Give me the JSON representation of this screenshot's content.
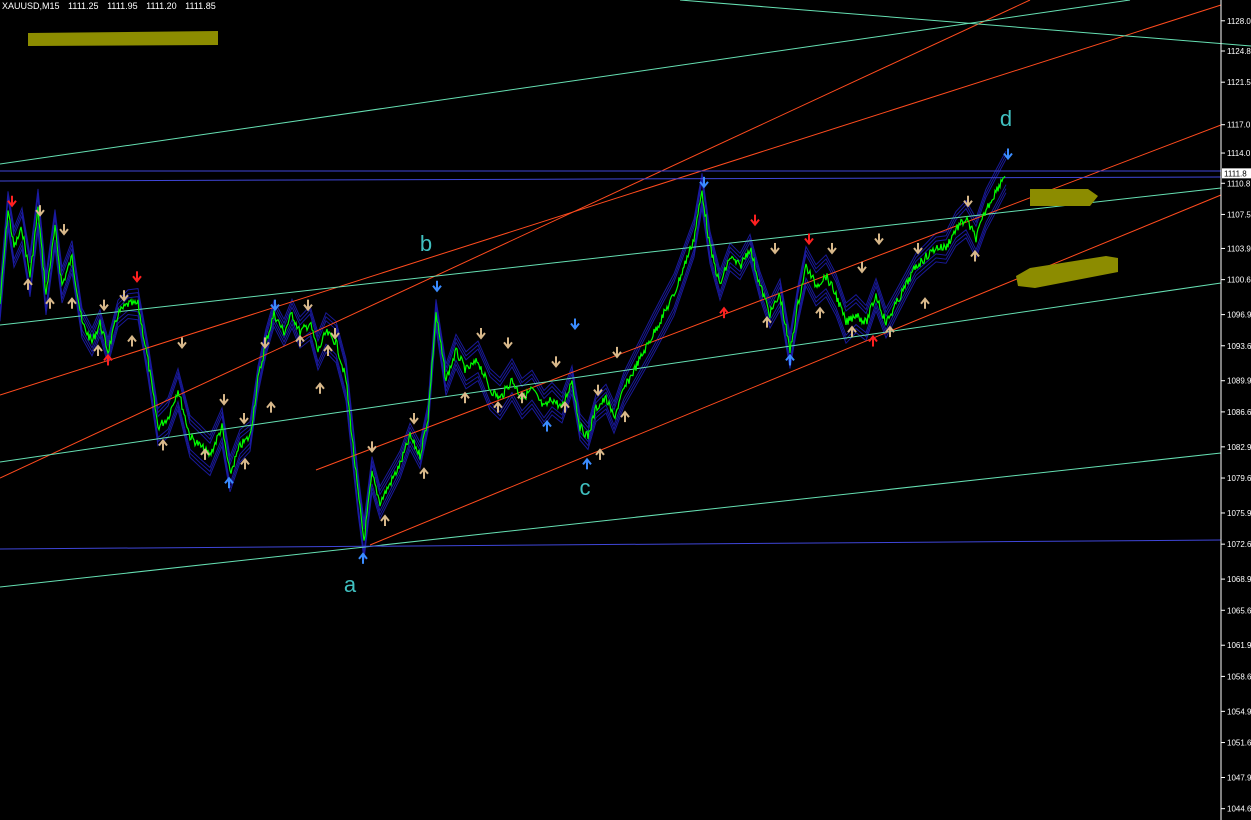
{
  "header": {
    "symbol_tf": "XAUUSD,M15",
    "open": "1111.25",
    "high": "1111.95",
    "low": "1111.20",
    "close": "1111.85"
  },
  "colors": {
    "background": "#000000",
    "price": "#00ff00",
    "envelope": "#1c1ca8",
    "channel_orange": "#ff4b1e",
    "channel_green": "#66e0b3",
    "horizontal": "#3f46d8",
    "label": "#40c0c0",
    "arrow_up_tan": "#d8b88a",
    "arrow_blue": "#3a8cff",
    "arrow_red": "#ff2020",
    "marker_olive": "#8c8c00",
    "axis_text": "#ffffff"
  },
  "chart_data": {
    "type": "line",
    "symbol": "XAUUSD",
    "timeframe": "M15",
    "ylim": [
      1043.0,
      1130.0
    ],
    "y_ticks": [
      "1128.0",
      "1124.8",
      "1121.5",
      "1117.0",
      "1114.0",
      "1110.8",
      "1107.5",
      "1103.9",
      "1100.6",
      "1096.9",
      "1093.6",
      "1089.9",
      "1086.6",
      "1082.9",
      "1079.6",
      "1075.9",
      "1072.6",
      "1068.9",
      "1065.6",
      "1061.9",
      "1058.6",
      "1054.9",
      "1051.6",
      "1047.9",
      "1044.6"
    ],
    "current_price_label": "1111.8",
    "current_price": 1111.85,
    "wave_labels": [
      {
        "label": "a",
        "price": 1072.6
      },
      {
        "label": "b",
        "price": 1103.9
      },
      {
        "label": "c",
        "price": 1082.9
      },
      {
        "label": "d",
        "price": 1111.9
      }
    ],
    "price_path": [
      [
        0,
        1098
      ],
      [
        8,
        1108
      ],
      [
        14,
        1104
      ],
      [
        22,
        1106
      ],
      [
        30,
        1101
      ],
      [
        38,
        1108
      ],
      [
        46,
        1099
      ],
      [
        55,
        1106
      ],
      [
        62,
        1100
      ],
      [
        72,
        1103
      ],
      [
        82,
        1096
      ],
      [
        92,
        1094
      ],
      [
        100,
        1096
      ],
      [
        108,
        1093
      ],
      [
        118,
        1097
      ],
      [
        128,
        1098
      ],
      [
        138,
        1098
      ],
      [
        148,
        1092
      ],
      [
        158,
        1085
      ],
      [
        168,
        1086
      ],
      [
        178,
        1089
      ],
      [
        190,
        1084
      ],
      [
        200,
        1083
      ],
      [
        210,
        1082
      ],
      [
        222,
        1085
      ],
      [
        230,
        1080
      ],
      [
        240,
        1083
      ],
      [
        250,
        1084
      ],
      [
        258,
        1090
      ],
      [
        266,
        1094
      ],
      [
        274,
        1097
      ],
      [
        284,
        1095
      ],
      [
        292,
        1097
      ],
      [
        300,
        1095
      ],
      [
        310,
        1096
      ],
      [
        318,
        1093
      ],
      [
        326,
        1095
      ],
      [
        336,
        1094
      ],
      [
        346,
        1090
      ],
      [
        352,
        1084
      ],
      [
        358,
        1078
      ],
      [
        364,
        1073
      ],
      [
        372,
        1080
      ],
      [
        380,
        1077
      ],
      [
        390,
        1079
      ],
      [
        400,
        1081
      ],
      [
        410,
        1084
      ],
      [
        420,
        1082
      ],
      [
        428,
        1086
      ],
      [
        436,
        1097
      ],
      [
        446,
        1090
      ],
      [
        456,
        1093
      ],
      [
        466,
        1091
      ],
      [
        478,
        1092
      ],
      [
        490,
        1089
      ],
      [
        500,
        1088
      ],
      [
        512,
        1090
      ],
      [
        522,
        1088
      ],
      [
        532,
        1089
      ],
      [
        544,
        1087
      ],
      [
        552,
        1088
      ],
      [
        562,
        1087
      ],
      [
        572,
        1090
      ],
      [
        580,
        1085
      ],
      [
        588,
        1084
      ],
      [
        596,
        1087
      ],
      [
        606,
        1088
      ],
      [
        614,
        1086
      ],
      [
        624,
        1089
      ],
      [
        634,
        1091
      ],
      [
        644,
        1093
      ],
      [
        654,
        1095
      ],
      [
        664,
        1097
      ],
      [
        674,
        1099
      ],
      [
        684,
        1102
      ],
      [
        694,
        1105
      ],
      [
        702,
        1110
      ],
      [
        710,
        1104
      ],
      [
        720,
        1100
      ],
      [
        730,
        1103
      ],
      [
        740,
        1102
      ],
      [
        750,
        1104
      ],
      [
        760,
        1100
      ],
      [
        770,
        1097
      ],
      [
        780,
        1099
      ],
      [
        790,
        1093
      ],
      [
        798,
        1098
      ],
      [
        806,
        1102
      ],
      [
        816,
        1100
      ],
      [
        826,
        1101
      ],
      [
        836,
        1099
      ],
      [
        846,
        1096
      ],
      [
        856,
        1097
      ],
      [
        866,
        1096
      ],
      [
        876,
        1099
      ],
      [
        886,
        1096
      ],
      [
        896,
        1098
      ],
      [
        906,
        1100
      ],
      [
        916,
        1102
      ],
      [
        926,
        1103
      ],
      [
        936,
        1104
      ],
      [
        946,
        1104
      ],
      [
        956,
        1106
      ],
      [
        966,
        1107
      ],
      [
        976,
        1105
      ],
      [
        986,
        1108
      ],
      [
        996,
        1110
      ],
      [
        1006,
        1112
      ]
    ],
    "arrows": [
      {
        "dir": "down",
        "color": "red",
        "px": 12,
        "price": 1108
      },
      {
        "dir": "down",
        "color": "tan",
        "px": 40,
        "price": 1107
      },
      {
        "dir": "down",
        "color": "tan",
        "px": 64,
        "price": 1105
      },
      {
        "dir": "up",
        "color": "tan",
        "px": 28,
        "price": 1101
      },
      {
        "dir": "up",
        "color": "tan",
        "px": 50,
        "price": 1099
      },
      {
        "dir": "up",
        "color": "tan",
        "px": 72,
        "price": 1099
      },
      {
        "dir": "down",
        "color": "tan",
        "px": 104,
        "price": 1097
      },
      {
        "dir": "up",
        "color": "red",
        "px": 108,
        "price": 1093
      },
      {
        "dir": "up",
        "color": "tan",
        "px": 98,
        "price": 1094
      },
      {
        "dir": "down",
        "color": "tan",
        "px": 124,
        "price": 1098
      },
      {
        "dir": "down",
        "color": "red",
        "px": 137,
        "price": 1100
      },
      {
        "dir": "up",
        "color": "tan",
        "px": 132,
        "price": 1095
      },
      {
        "dir": "down",
        "color": "tan",
        "px": 182,
        "price": 1093
      },
      {
        "dir": "up",
        "color": "tan",
        "px": 163,
        "price": 1084
      },
      {
        "dir": "up",
        "color": "tan",
        "px": 205,
        "price": 1083
      },
      {
        "dir": "down",
        "color": "tan",
        "px": 224,
        "price": 1087
      },
      {
        "dir": "up",
        "color": "blue",
        "px": 229,
        "price": 1080
      },
      {
        "dir": "down",
        "color": "tan",
        "px": 244,
        "price": 1085
      },
      {
        "dir": "up",
        "color": "tan",
        "px": 245,
        "price": 1082
      },
      {
        "dir": "down",
        "color": "tan",
        "px": 265,
        "price": 1093
      },
      {
        "dir": "up",
        "color": "tan",
        "px": 271,
        "price": 1088
      },
      {
        "dir": "down",
        "color": "blue",
        "px": 275,
        "price": 1097
      },
      {
        "dir": "down",
        "color": "tan",
        "px": 308,
        "price": 1097
      },
      {
        "dir": "up",
        "color": "tan",
        "px": 300,
        "price": 1095
      },
      {
        "dir": "down",
        "color": "tan",
        "px": 335,
        "price": 1094
      },
      {
        "dir": "up",
        "color": "tan",
        "px": 320,
        "price": 1090
      },
      {
        "dir": "up",
        "color": "tan",
        "px": 328,
        "price": 1094
      },
      {
        "dir": "down",
        "color": "tan",
        "px": 372,
        "price": 1082
      },
      {
        "dir": "up",
        "color": "tan",
        "px": 385,
        "price": 1076
      },
      {
        "dir": "up",
        "color": "blue",
        "px": 363,
        "price": 1072
      },
      {
        "dir": "down",
        "color": "tan",
        "px": 414,
        "price": 1085
      },
      {
        "dir": "up",
        "color": "tan",
        "px": 424,
        "price": 1081
      },
      {
        "dir": "down",
        "color": "blue",
        "px": 437,
        "price": 1099
      },
      {
        "dir": "down",
        "color": "tan",
        "px": 481,
        "price": 1094
      },
      {
        "dir": "up",
        "color": "tan",
        "px": 465,
        "price": 1089
      },
      {
        "dir": "down",
        "color": "tan",
        "px": 508,
        "price": 1093
      },
      {
        "dir": "up",
        "color": "tan",
        "px": 498,
        "price": 1088
      },
      {
        "dir": "up",
        "color": "tan",
        "px": 522,
        "price": 1089
      },
      {
        "dir": "up",
        "color": "blue",
        "px": 547,
        "price": 1086
      },
      {
        "dir": "down",
        "color": "tan",
        "px": 556,
        "price": 1091
      },
      {
        "dir": "up",
        "color": "tan",
        "px": 565,
        "price": 1088
      },
      {
        "dir": "down",
        "color": "blue",
        "px": 575,
        "price": 1095
      },
      {
        "dir": "up",
        "color": "blue",
        "px": 587,
        "price": 1082
      },
      {
        "dir": "up",
        "color": "tan",
        "px": 600,
        "price": 1083
      },
      {
        "dir": "down",
        "color": "tan",
        "px": 598,
        "price": 1088
      },
      {
        "dir": "down",
        "color": "tan",
        "px": 617,
        "price": 1092
      },
      {
        "dir": "up",
        "color": "tan",
        "px": 625,
        "price": 1087
      },
      {
        "dir": "down",
        "color": "blue",
        "px": 704,
        "price": 1110
      },
      {
        "dir": "up",
        "color": "red",
        "px": 724,
        "price": 1098
      },
      {
        "dir": "down",
        "color": "red",
        "px": 755,
        "price": 1106
      },
      {
        "dir": "down",
        "color": "tan",
        "px": 775,
        "price": 1103
      },
      {
        "dir": "up",
        "color": "tan",
        "px": 767,
        "price": 1097
      },
      {
        "dir": "up",
        "color": "blue",
        "px": 790,
        "price": 1093
      },
      {
        "dir": "down",
        "color": "red",
        "px": 809,
        "price": 1104
      },
      {
        "dir": "up",
        "color": "tan",
        "px": 820,
        "price": 1098
      },
      {
        "dir": "down",
        "color": "tan",
        "px": 832,
        "price": 1103
      },
      {
        "dir": "up",
        "color": "tan",
        "px": 852,
        "price": 1096
      },
      {
        "dir": "down",
        "color": "tan",
        "px": 862,
        "price": 1101
      },
      {
        "dir": "up",
        "color": "red",
        "px": 873,
        "price": 1095
      },
      {
        "dir": "down",
        "color": "tan",
        "px": 879,
        "price": 1104
      },
      {
        "dir": "up",
        "color": "tan",
        "px": 890,
        "price": 1096
      },
      {
        "dir": "down",
        "color": "tan",
        "px": 918,
        "price": 1103
      },
      {
        "dir": "up",
        "color": "tan",
        "px": 925,
        "price": 1099
      },
      {
        "dir": "down",
        "color": "tan",
        "px": 968,
        "price": 1108
      },
      {
        "dir": "up",
        "color": "tan",
        "px": 975,
        "price": 1104
      },
      {
        "dir": "down",
        "color": "blue",
        "px": 1008,
        "price": 1113
      }
    ],
    "horizontal_lines": [
      1111.85,
      1072.6
    ],
    "grid": false
  }
}
